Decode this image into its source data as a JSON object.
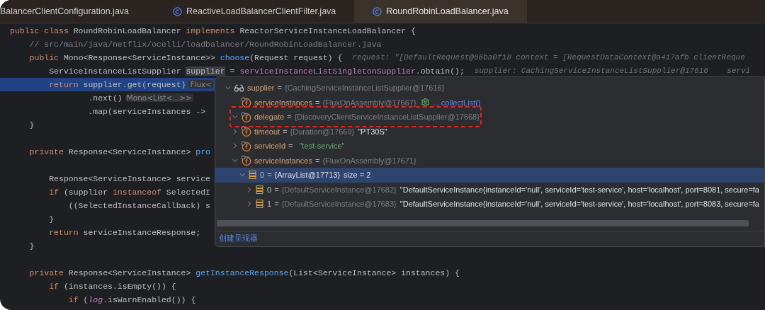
{
  "tabs": [
    {
      "label": "BalancerClientConfiguration.java",
      "kind": "file",
      "selected": false
    },
    {
      "label": "ReactiveLoadBalancerClientFilter.java",
      "kind": "class_file",
      "selected": false
    },
    {
      "label": "RoundRobinLoadBalancer.java",
      "kind": "class_file",
      "selected": true
    }
  ],
  "code_lines": [
    {
      "kind": "code",
      "current": false,
      "tokens": [
        {
          "kind": "keyword",
          "text": "public class "
        },
        {
          "kind": "plain",
          "text": "RoundRobinLoadBalancer "
        },
        {
          "kind": "keyword",
          "text": "implements "
        },
        {
          "kind": "plain",
          "text": "ReactorServiceInstanceLoadBalancer {"
        }
      ]
    },
    {
      "kind": "code",
      "current": false,
      "tokens": [
        {
          "kind": "comment",
          "text": "    // src/main/java/netflix/ocelli/loadbalancer/RoundRobinLoadBalancer.java"
        }
      ]
    },
    {
      "kind": "code",
      "current": false,
      "tokens": [
        {
          "kind": "keyword",
          "text": "    public "
        },
        {
          "kind": "plain",
          "text": "Mono<Response<ServiceInstance>> "
        },
        {
          "kind": "method",
          "text": "choose"
        },
        {
          "kind": "plain",
          "text": "(Request request) {"
        }
      ],
      "hint": "request: \"[DefaultRequest@66ba0f18 context = [RequestDataContext@a417afb clientReque"
    },
    {
      "kind": "code",
      "current": false,
      "tokens": [
        {
          "kind": "plain",
          "text": "        ServiceInstanceListSupplier "
        },
        {
          "kind": "marked",
          "text": "supplier"
        },
        {
          "kind": "plain",
          "text": " = "
        },
        {
          "kind": "field",
          "text": "serviceInstanceListSingletonSupplier"
        },
        {
          "kind": "plain",
          "text": ".obtain();"
        }
      ],
      "hint": "supplier: CachingServiceInstanceListSupplier@17616    servi"
    },
    {
      "kind": "code",
      "current": true,
      "tokens": [
        {
          "kind": "keyword",
          "text": "        return "
        },
        {
          "kind": "plain",
          "text": "supplier.get(request)"
        },
        {
          "kind": "chip",
          "text": "Flux<"
        }
      ]
    },
    {
      "kind": "code",
      "current": false,
      "tokens": [
        {
          "kind": "plain",
          "text": "                .next()"
        },
        {
          "kind": "chip",
          "text": "Mono<List<...>>"
        }
      ]
    },
    {
      "kind": "code",
      "current": false,
      "tokens": [
        {
          "kind": "plain",
          "text": "                .map(serviceInstances ->"
        }
      ]
    },
    {
      "kind": "code",
      "current": false,
      "tokens": [
        {
          "kind": "plain",
          "text": "    }"
        }
      ]
    },
    {
      "kind": "blank",
      "current": false
    },
    {
      "kind": "code",
      "current": false,
      "tokens": [
        {
          "kind": "keyword",
          "text": "    private "
        },
        {
          "kind": "plain",
          "text": "Response<ServiceInstance> "
        },
        {
          "kind": "method",
          "text": "pro"
        }
      ]
    },
    {
      "kind": "blank",
      "current": false
    },
    {
      "kind": "code",
      "current": false,
      "tokens": [
        {
          "kind": "plain",
          "text": "        Response<ServiceInstance> service"
        }
      ]
    },
    {
      "kind": "code",
      "current": false,
      "tokens": [
        {
          "kind": "keyword",
          "text": "        if "
        },
        {
          "kind": "plain",
          "text": "(supplier "
        },
        {
          "kind": "keyword",
          "text": "instanceof "
        },
        {
          "kind": "plain",
          "text": "SelectedI"
        }
      ]
    },
    {
      "kind": "code",
      "current": false,
      "tokens": [
        {
          "kind": "plain",
          "text": "            ((SelectedInstanceCallback) s"
        }
      ]
    },
    {
      "kind": "code",
      "current": false,
      "tokens": [
        {
          "kind": "plain",
          "text": "        }"
        }
      ]
    },
    {
      "kind": "code",
      "current": false,
      "tokens": [
        {
          "kind": "keyword",
          "text": "        return "
        },
        {
          "kind": "plain",
          "text": "serviceInstanceResponse;"
        }
      ]
    },
    {
      "kind": "code",
      "current": false,
      "tokens": [
        {
          "kind": "plain",
          "text": "    }"
        }
      ]
    },
    {
      "kind": "blank",
      "current": false
    },
    {
      "kind": "code",
      "current": false,
      "tokens": [
        {
          "kind": "keyword",
          "text": "    private "
        },
        {
          "kind": "plain",
          "text": "Response<ServiceInstance> "
        },
        {
          "kind": "method",
          "text": "getInstanceResponse"
        },
        {
          "kind": "plain",
          "text": "(List<ServiceInstance> instances) {"
        }
      ]
    },
    {
      "kind": "code",
      "current": false,
      "tokens": [
        {
          "kind": "keyword",
          "text": "        if "
        },
        {
          "kind": "plain",
          "text": "(instances.isEmpty()) {"
        }
      ]
    },
    {
      "kind": "code",
      "current": false,
      "tokens": [
        {
          "kind": "keyword",
          "text": "            if "
        },
        {
          "kind": "plain",
          "text": "("
        },
        {
          "kind": "static",
          "text": "log"
        },
        {
          "kind": "plain",
          "text": ".isWarnEnabled()) {"
        }
      ]
    }
  ],
  "debug_popup": {
    "tree": [
      {
        "kind": "watch",
        "name": "supplier",
        "operator": "=",
        "value": "{CachingServiceInstanceListSupplier@17616}",
        "expanded": true,
        "selected": false,
        "children": [
          {
            "kind": "field",
            "name": "serviceInstances",
            "operator": "=",
            "value": "{FluxOnAssembly@17667}",
            "action": "... collectList()",
            "selected": false
          },
          {
            "kind": "field",
            "name": "delegate",
            "operator": "=",
            "value": "{DiscoveryClientServiceInstanceListSupplier@17668}",
            "expanded": true,
            "selected": false,
            "framed": true
          },
          {
            "kind": "field",
            "name": "timeout",
            "operator": "=",
            "value": "{Duration@17669}",
            "detail": {
              "kind": "plain",
              "text": "\"PT30S\""
            },
            "expanded": false,
            "selected": false
          },
          {
            "kind": "field",
            "name": "serviceId",
            "operator": "=",
            "detail": {
              "kind": "string",
              "text": "\"test-service\""
            },
            "expanded": false,
            "selected": false
          },
          {
            "kind": "field",
            "name": "serviceInstances",
            "operator": "=",
            "value": "{FluxOnAssembly@17671}",
            "expanded": true,
            "selected": false,
            "children": [
              {
                "kind": "array",
                "name": "0",
                "operator": "=",
                "value": "{ArrayList@17713}",
                "detail": {
                  "kind": "plain",
                  "text": "size = 2"
                },
                "expanded": true,
                "selected": true,
                "children": [
                  {
                    "kind": "array",
                    "name": "0",
                    "operator": "=",
                    "value": "{DefaultServiceInstance@17682}",
                    "detail": {
                      "kind": "plain",
                      "text": "\"DefaultServiceInstance{instanceId='null', serviceId='test-service', host='localhost', port=8081, secure=fa"
                    },
                    "expanded": false,
                    "selected": false
                  },
                  {
                    "kind": "array",
                    "name": "1",
                    "operator": "=",
                    "value": "{DefaultServiceInstance@17683}",
                    "detail": {
                      "kind": "plain",
                      "text": "\"DefaultServiceInstance{instanceId='null', serviceId='test-service', host='localhost', port=8083, secure=fa"
                    },
                    "expanded": false,
                    "selected": false
                  }
                ]
              }
            ]
          }
        ]
      }
    ],
    "footer_link": "创建呈现器"
  }
}
